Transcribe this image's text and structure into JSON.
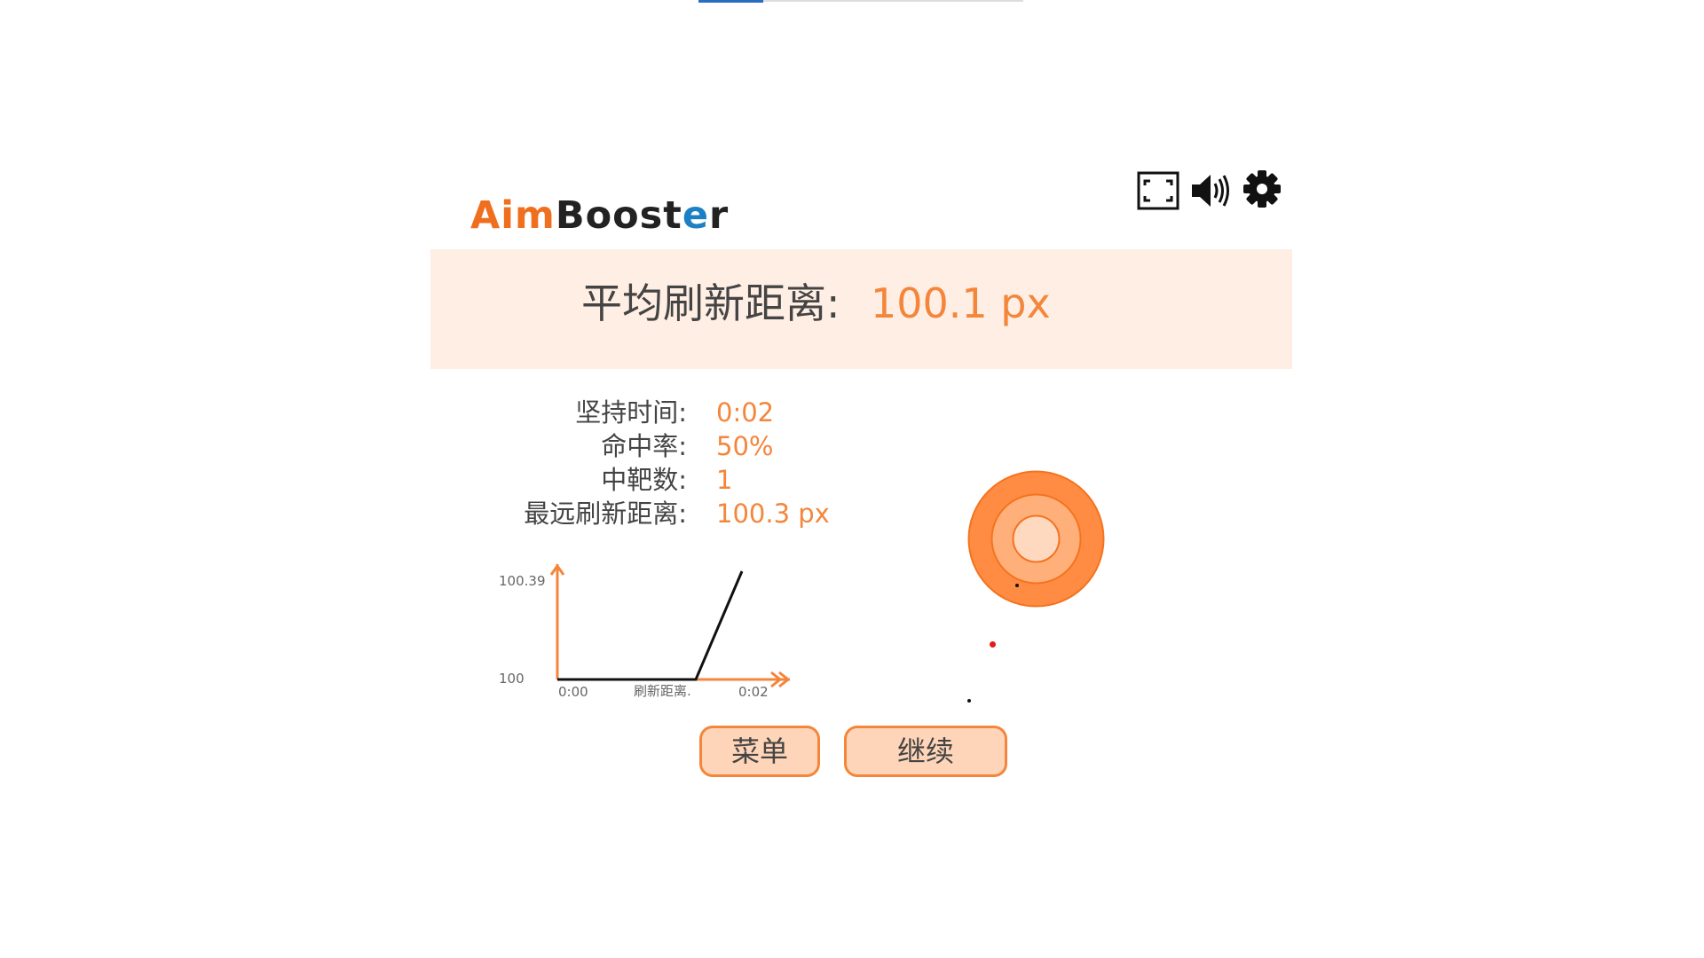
{
  "app": {
    "logo_part1": "Aim",
    "logo_part2": "Boost",
    "logo_part3": "e",
    "logo_part4": "r"
  },
  "toolbar": {
    "fullscreen_icon": "fullscreen-icon",
    "sound_icon": "speaker-icon",
    "settings_icon": "gear-icon"
  },
  "result": {
    "label": "平均刷新距离:",
    "value": "100.1 px"
  },
  "stats": [
    {
      "label": "坚持时间:",
      "value": "0:02"
    },
    {
      "label": "命中率:",
      "value": "50%"
    },
    {
      "label": "中靶数:",
      "value": "1"
    },
    {
      "label": "最远刷新距离:",
      "value": "100.3 px"
    }
  ],
  "chart_data": {
    "type": "line",
    "xlabel": "刷新距离.",
    "ylabel": "",
    "x_tick_labels": [
      "0:00",
      "0:02"
    ],
    "y_tick_labels": [
      "100",
      "100.39"
    ],
    "x": [
      0,
      1.2,
      1.6
    ],
    "y": [
      100,
      100,
      100.39
    ],
    "ylim": [
      100,
      100.39
    ],
    "xlim": [
      0,
      2
    ],
    "series": [
      {
        "values": [
          100,
          100,
          100.39
        ]
      }
    ]
  },
  "buttons": {
    "menu": "菜单",
    "continue": "继续"
  },
  "colors": {
    "accent": "#f4863c",
    "accent_light": "#ffd5b9",
    "banner_bg": "#ffeee4",
    "target_outer": "#ff8c42",
    "target_mid": "#ffb07a",
    "target_inner": "#ffd9bf",
    "miss_dot": "#e31b1b"
  }
}
